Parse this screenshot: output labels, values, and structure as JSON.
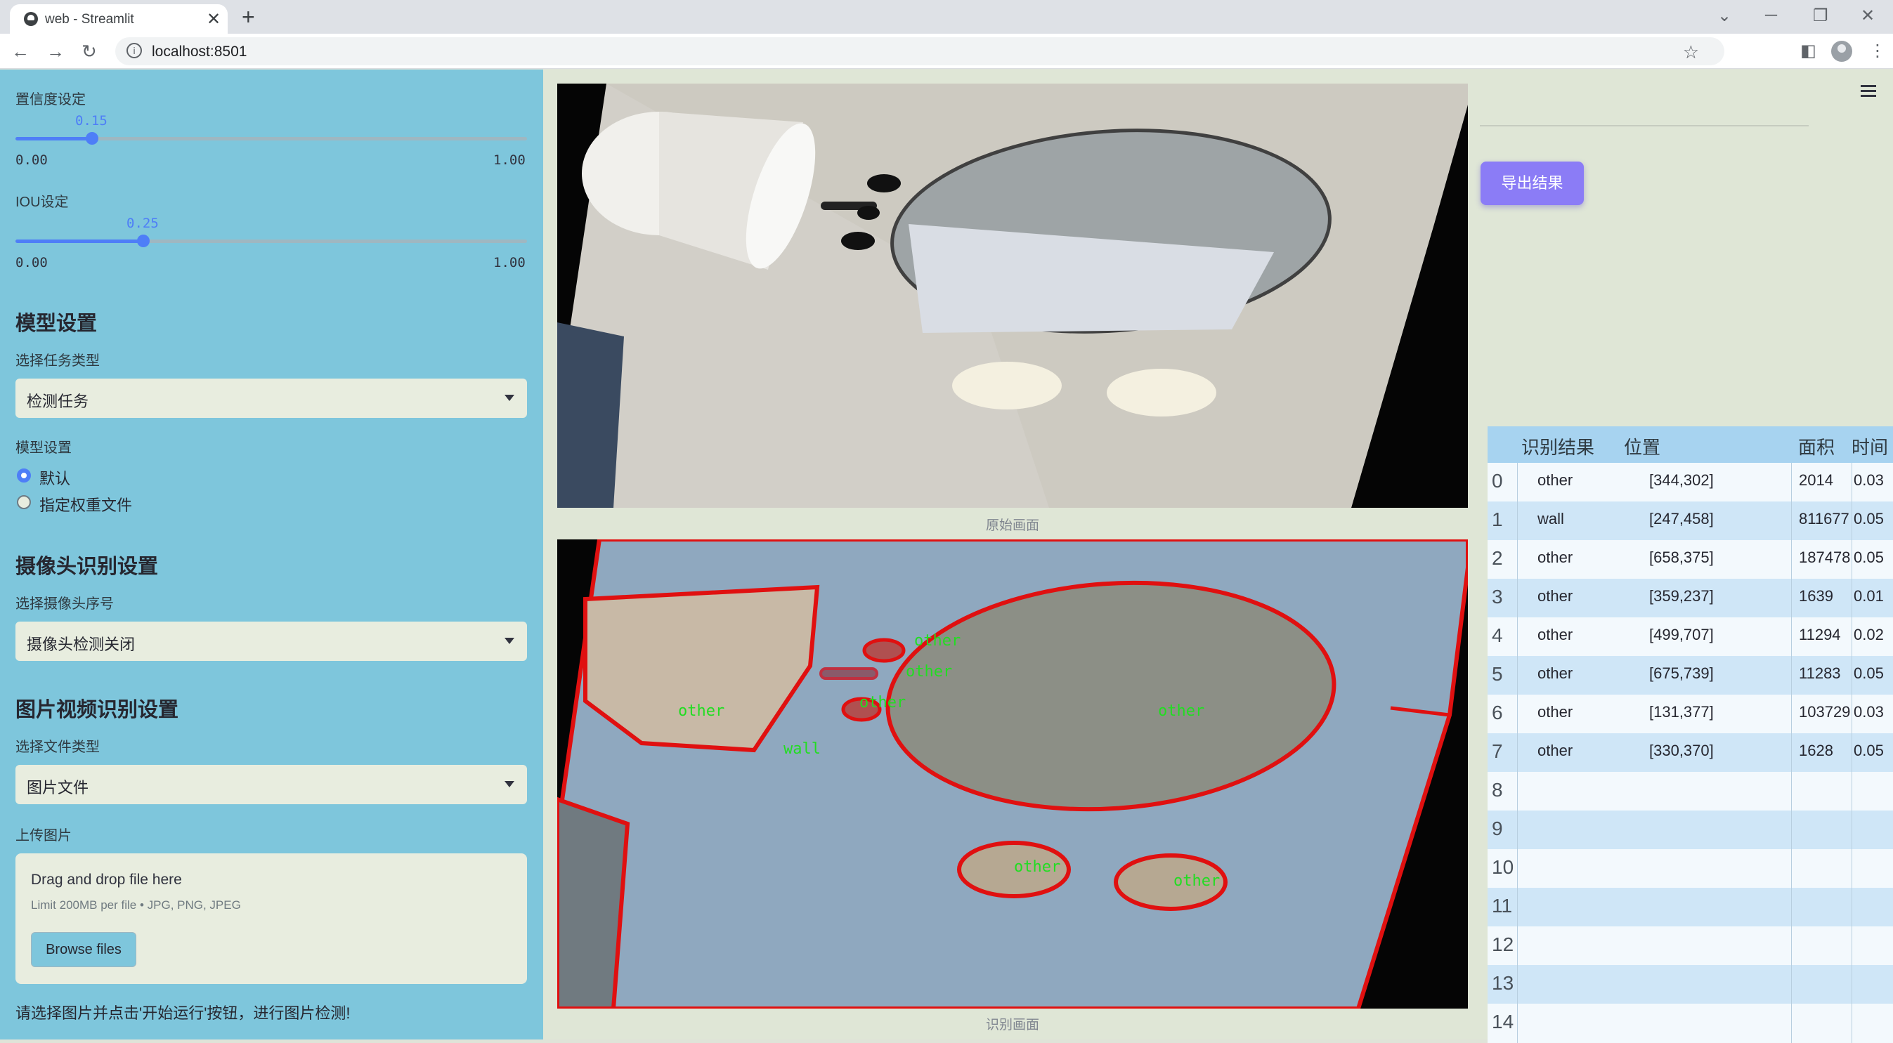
{
  "browser": {
    "tab_title": "web - Streamlit",
    "url": "localhost:8501"
  },
  "sidebar": {
    "confidence": {
      "label": "置信度设定",
      "value": "0.15",
      "min": "0.00",
      "max": "1.00",
      "fraction": 0.15
    },
    "iou": {
      "label": "IOU设定",
      "value": "0.25",
      "min": "0.00",
      "max": "1.00",
      "fraction": 0.25
    },
    "model_section": "模型设置",
    "task_label": "选择任务类型",
    "task_value": "检测任务",
    "model_label": "模型设置",
    "model_options": [
      "默认",
      "指定权重文件"
    ],
    "camera_section": "摄像头识别设置",
    "camera_label": "选择摄像头序号",
    "camera_value": "摄像头检测关闭",
    "media_section": "图片视频识别设置",
    "file_type_label": "选择文件类型",
    "file_type_value": "图片文件",
    "upload_label": "上传图片",
    "upload_title": "Drag and drop file here",
    "upload_limit": "Limit 200MB per file • JPG, PNG, JPEG",
    "browse_label": "Browse files",
    "hint": "请选择图片并点击'开始运行'按钮，进行图片检测!"
  },
  "main": {
    "original_caption": "原始画面",
    "result_caption": "识别画面",
    "detection_labels": [
      "other",
      "other",
      "other",
      "other",
      "other",
      "wall",
      "other",
      "other",
      "other"
    ],
    "export_label": "导出结果"
  },
  "table": {
    "headers": [
      "识别结果",
      "位置",
      "面积",
      "时间"
    ],
    "rows": [
      {
        "idx": "0",
        "label": "other",
        "pos": "[344,302]",
        "area": "2014",
        "time": "0.03"
      },
      {
        "idx": "1",
        "label": "wall",
        "pos": "[247,458]",
        "area": "811677",
        "time": "0.05"
      },
      {
        "idx": "2",
        "label": "other",
        "pos": "[658,375]",
        "area": "187478",
        "time": "0.05"
      },
      {
        "idx": "3",
        "label": "other",
        "pos": "[359,237]",
        "area": "1639",
        "time": "0.01"
      },
      {
        "idx": "4",
        "label": "other",
        "pos": "[499,707]",
        "area": "11294",
        "time": "0.02"
      },
      {
        "idx": "5",
        "label": "other",
        "pos": "[675,739]",
        "area": "11283",
        "time": "0.05"
      },
      {
        "idx": "6",
        "label": "other",
        "pos": "[131,377]",
        "area": "103729",
        "time": "0.03"
      },
      {
        "idx": "7",
        "label": "other",
        "pos": "[330,370]",
        "area": "1628",
        "time": "0.05"
      },
      {
        "idx": "8",
        "label": "",
        "pos": "",
        "area": "",
        "time": ""
      },
      {
        "idx": "9",
        "label": "",
        "pos": "",
        "area": "",
        "time": ""
      },
      {
        "idx": "10",
        "label": "",
        "pos": "",
        "area": "",
        "time": ""
      },
      {
        "idx": "11",
        "label": "",
        "pos": "",
        "area": "",
        "time": ""
      },
      {
        "idx": "12",
        "label": "",
        "pos": "",
        "area": "",
        "time": ""
      },
      {
        "idx": "13",
        "label": "",
        "pos": "",
        "area": "",
        "time": ""
      },
      {
        "idx": "14",
        "label": "",
        "pos": "",
        "area": "",
        "time": ""
      }
    ]
  },
  "colors": {
    "sidebar": "#7ec6dc",
    "accent": "#4e7ef7",
    "export": "#8b7cf6",
    "mask": "#e01010",
    "label": "#22dd22"
  }
}
